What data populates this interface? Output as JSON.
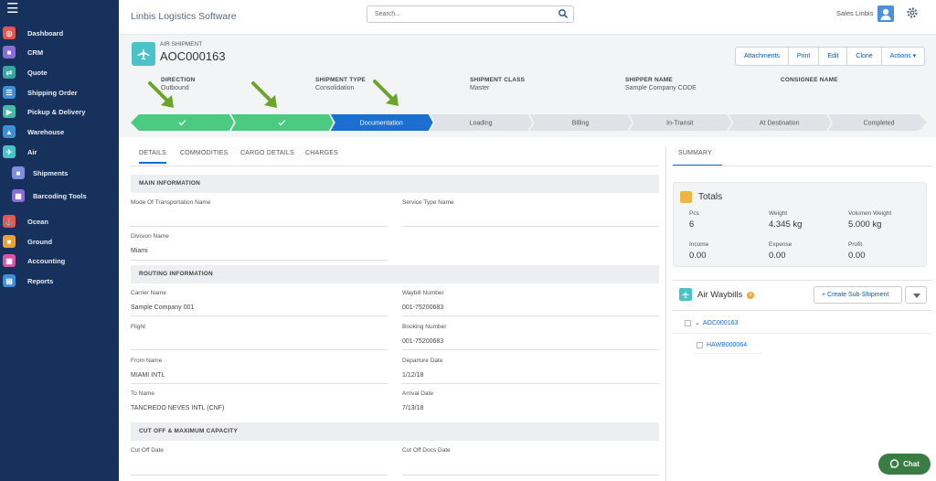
{
  "app": {
    "title": "Linbis Logistics Software"
  },
  "search": {
    "placeholder": "Search..."
  },
  "user": {
    "name": "Sales Linbis"
  },
  "sidebar": {
    "items": [
      {
        "label": "Dashboard",
        "color": "#e8544e"
      },
      {
        "label": "CRM",
        "color": "#8b6bd6"
      },
      {
        "label": "Quote",
        "color": "#37a7a4"
      },
      {
        "label": "Shipping Order",
        "color": "#3e8ed8"
      },
      {
        "label": "Pickup & Delivery",
        "color": "#48b9a8"
      },
      {
        "label": "Warehouse",
        "color": "#3e8ed8"
      },
      {
        "label": "Air",
        "color": "#4bc1c9"
      },
      {
        "label": "Shipments",
        "color": "#7f8de0"
      },
      {
        "label": "Barcoding Tools",
        "color": "#8b6bd6"
      },
      {
        "label": "Ocean",
        "color": "#e8544e"
      },
      {
        "label": "Ground",
        "color": "#e8a23b"
      },
      {
        "label": "Accounting",
        "color": "#d657a8"
      },
      {
        "label": "Reports",
        "color": "#3e8ed8"
      }
    ]
  },
  "record": {
    "type": "AIR SHIPMENT",
    "title": "AOC000163"
  },
  "actions": [
    "Attachments",
    "Print",
    "Edit",
    "Clone",
    "Actions"
  ],
  "header_fields": [
    {
      "label": "DIRECTION",
      "value": "Outbound"
    },
    {
      "label": "SHIPMENT TYPE",
      "value": "Consolidation"
    },
    {
      "label": "SHIPMENT CLASS",
      "value": "Master"
    },
    {
      "label": "SHIPPER NAME",
      "value": "Sample Company CODE"
    },
    {
      "label": "CONSIGNEE NAME",
      "value": ""
    }
  ],
  "path": {
    "stages": [
      "",
      "",
      "Documentation",
      "Loading",
      "Billing",
      "In-Transit",
      "At Destination",
      "Completed"
    ],
    "complete_color": "#4bca81",
    "current_color": "#1a6fd1",
    "pending_color": "#dfe2e7"
  },
  "tabs": [
    "DETAILS",
    "COMMODITIES",
    "CARGO DETAILS",
    "CHARGES"
  ],
  "sections": {
    "main": "MAIN INFORMATION",
    "routing": "ROUTING INFORMATION",
    "cutoff": "CUT OFF & MAXIMUM CAPACITY"
  },
  "fields": {
    "mode": {
      "label": "Mode Of Transportation Name",
      "value": ""
    },
    "service": {
      "label": "Service Type Name",
      "value": ""
    },
    "division": {
      "label": "Division Name",
      "value": "Miami"
    },
    "carrier": {
      "label": "Carrier Name",
      "value": "Sample Company 001"
    },
    "waybill": {
      "label": "Waybill Number",
      "value": "001-75200683"
    },
    "flight": {
      "label": "Flight",
      "value": ""
    },
    "booking": {
      "label": "Booking Number",
      "value": "001-75200683"
    },
    "from": {
      "label": "From Name",
      "value": "MIAMI INTL"
    },
    "departure": {
      "label": "Departure Date",
      "value": "1/12/18"
    },
    "to": {
      "label": "To Name",
      "value": "TANCREDO NEVES INTL (CNF)"
    },
    "arrival": {
      "label": "Arrival Date",
      "value": "7/13/18"
    },
    "cutoff": {
      "label": "Cut Off Date",
      "value": ""
    },
    "cutoff_docs": {
      "label": "Cut Off Docs Date",
      "value": ""
    }
  },
  "summary": {
    "tab": "SUMMARY",
    "totals_title": "Totals",
    "metrics": [
      {
        "label": "Pcs",
        "value": "6"
      },
      {
        "label": "Weight",
        "value": "4.345 kg"
      },
      {
        "label": "Volumen Weight",
        "value": "5.000 kg"
      },
      {
        "label": "Income",
        "value": "0.00"
      },
      {
        "label": "Expense",
        "value": "0.00"
      },
      {
        "label": "Profit",
        "value": "0.00"
      }
    ]
  },
  "waybills": {
    "title": "Air Waybills",
    "count": "2",
    "create_label": "+ Create Sub-Shipment",
    "master": "AOC000163",
    "house": "HAWB000064"
  },
  "chat": {
    "label": "Chat"
  }
}
